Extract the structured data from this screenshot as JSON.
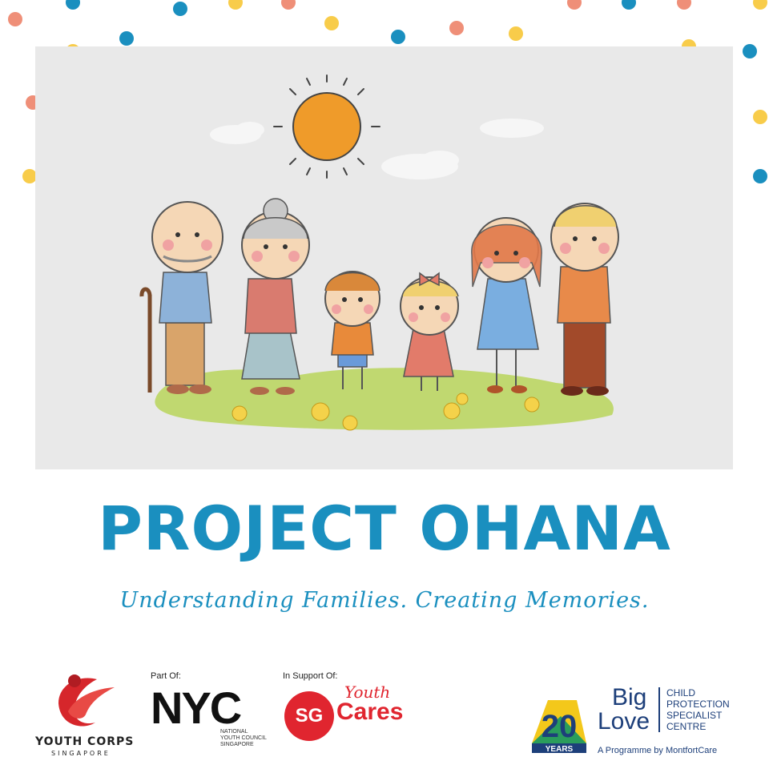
{
  "title": "PROJECT OHANA",
  "tagline": "Understanding Families. Creating Memories.",
  "colors": {
    "accent_blue": "#1a8fbf",
    "dot_salmon": "#ef8f78",
    "dot_yellow": "#f8cc4a",
    "illustration_bg": "#e9e9e9",
    "sg_red": "#e0252f",
    "biglove_navy": "#1d3f7a"
  },
  "illustration": {
    "subject": "family-illustration",
    "elements": [
      "sun-icon",
      "cloud-icon",
      "grandfather",
      "grandmother",
      "boy",
      "girl",
      "mother",
      "father",
      "grass",
      "flower-icon"
    ]
  },
  "logos": {
    "youth_corps": {
      "name": "YOUTH CORPS",
      "sub": "SINGAPORE"
    },
    "nyc": {
      "label": "Part Of:",
      "mark": "NYC",
      "small": "NATIONAL YOUTH COUNCIL SINGAPORE"
    },
    "sg_cares": {
      "label": "In Support Of:",
      "circle": "SG",
      "script": "Youth",
      "word": "Cares"
    },
    "big_love": {
      "years": "20",
      "years_label": "YEARS",
      "big": "Big",
      "love": "Love",
      "cpsc": [
        "CHILD",
        "PROTECTION",
        "SPECIALIST",
        "CENTRE"
      ],
      "programme": "A Programme by MontfortCare"
    }
  }
}
